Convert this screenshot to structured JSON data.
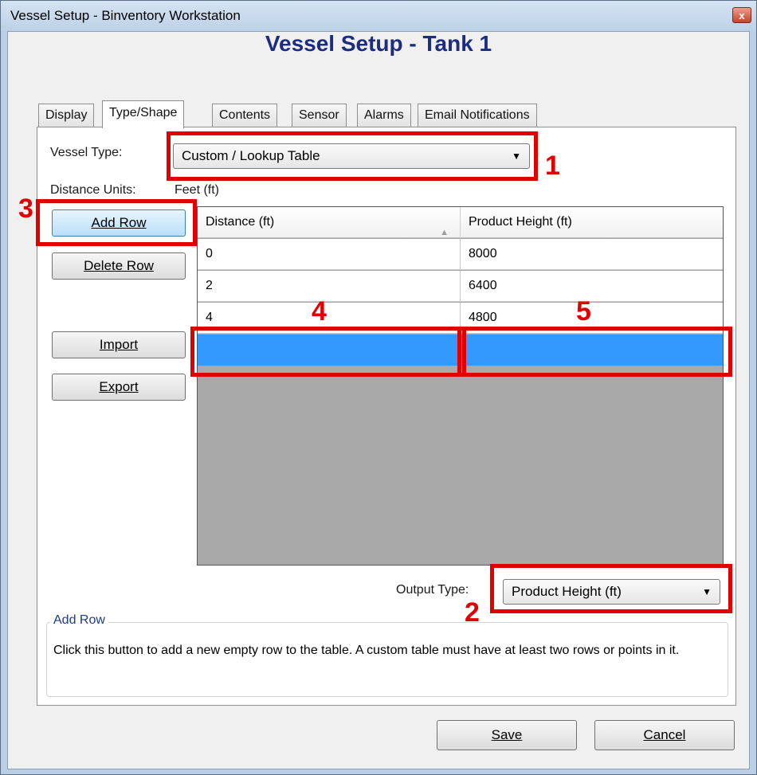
{
  "window": {
    "title": "Vessel Setup - Binventory Workstation",
    "close_label": "x"
  },
  "page_title": "Vessel Setup - Tank 1",
  "tabs": [
    {
      "label": "Display",
      "active": false
    },
    {
      "label": "Type/Shape",
      "active": true
    },
    {
      "label": "Contents",
      "active": false
    },
    {
      "label": "Sensor",
      "active": false
    },
    {
      "label": "Alarms",
      "active": false
    },
    {
      "label": "Email Notifications",
      "active": false
    }
  ],
  "vessel_type": {
    "label": "Vessel Type:",
    "value": "Custom / Lookup Table"
  },
  "distance_units": {
    "label": "Distance Units:",
    "value": "Feet (ft)"
  },
  "buttons": {
    "add_row": "Add Row",
    "delete_row": "Delete Row",
    "import": "Import",
    "export": "Export",
    "save": "Save",
    "cancel": "Cancel"
  },
  "grid": {
    "columns": [
      "Distance (ft)",
      "Product Height (ft)"
    ],
    "rows": [
      [
        "0",
        "8000"
      ],
      [
        "2",
        "6400"
      ],
      [
        "4",
        "4800"
      ],
      [
        "",
        ""
      ]
    ],
    "selected_row": 3
  },
  "output_type": {
    "label": "Output Type:",
    "value": "Product Height (ft)"
  },
  "help": {
    "title": "Add Row",
    "text": "Click this button to add a new empty row to the table. A custom table must have at least two rows or points in it."
  },
  "annotations": {
    "n1": "1",
    "n2": "2",
    "n3": "3",
    "n4": "4",
    "n5": "5"
  },
  "colors": {
    "annotation_red": "#e00000",
    "selection_blue": "#3399ff",
    "title_navy": "#1c2c80"
  }
}
